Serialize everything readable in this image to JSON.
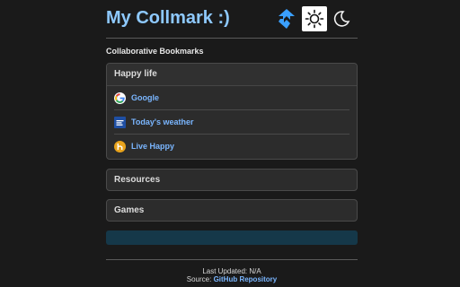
{
  "header": {
    "title": "My Collmark :)",
    "sync_icon": "sync-arrows-icon",
    "light_icon": "sun-icon",
    "dark_icon": "moon-icon"
  },
  "subtitle": "Collaborative Bookmarks",
  "sections": [
    {
      "name": "Happy life",
      "expanded": true,
      "bookmarks": [
        {
          "label": "Google",
          "icon": "google-icon"
        },
        {
          "label": "Today's weather",
          "icon": "weather-icon"
        },
        {
          "label": "Live Happy",
          "icon": "livehappy-icon"
        }
      ]
    },
    {
      "name": "Resources",
      "expanded": false
    },
    {
      "name": "Games",
      "expanded": false
    }
  ],
  "footer": {
    "last_updated": "Last Updated: N/A",
    "source_prefix": "Source:",
    "source_link": "GitHub Repository"
  },
  "colors": {
    "accent": "#8ec9ff",
    "link": "#7ab6ff",
    "background": "#1a1a1a",
    "bar": "#153849"
  }
}
